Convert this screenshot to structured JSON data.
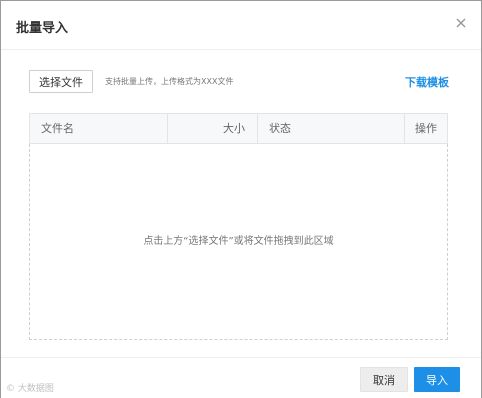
{
  "dialog": {
    "title": "批量导入",
    "close_icon": "close-icon"
  },
  "toolbar": {
    "select_file_label": "选择文件",
    "hint": "支持批量上传，上传格式为XXX文件",
    "download_template_label": "下载模板"
  },
  "table": {
    "columns": [
      "文件名",
      "大小",
      "状态",
      "操作"
    ]
  },
  "dropzone": {
    "text": "点击上方“选择文件”或将文件拖拽到此区域"
  },
  "footer": {
    "watermark": "© 大数据图",
    "cancel_label": "取消",
    "import_label": "导入"
  },
  "colors": {
    "accent": "#1e8fe6",
    "link": "#1f8fe5",
    "cancel_bg": "#ededed"
  }
}
